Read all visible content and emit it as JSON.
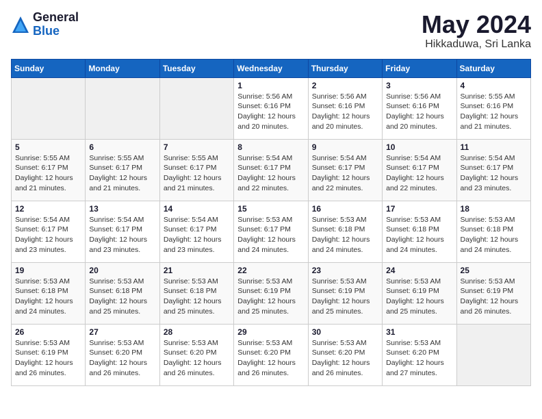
{
  "logo": {
    "general": "General",
    "blue": "Blue"
  },
  "title": "May 2024",
  "subtitle": "Hikkaduwa, Sri Lanka",
  "days_header": [
    "Sunday",
    "Monday",
    "Tuesday",
    "Wednesday",
    "Thursday",
    "Friday",
    "Saturday"
  ],
  "weeks": [
    [
      {
        "num": "",
        "detail": ""
      },
      {
        "num": "",
        "detail": ""
      },
      {
        "num": "",
        "detail": ""
      },
      {
        "num": "1",
        "detail": "Sunrise: 5:56 AM\nSunset: 6:16 PM\nDaylight: 12 hours\nand 20 minutes."
      },
      {
        "num": "2",
        "detail": "Sunrise: 5:56 AM\nSunset: 6:16 PM\nDaylight: 12 hours\nand 20 minutes."
      },
      {
        "num": "3",
        "detail": "Sunrise: 5:56 AM\nSunset: 6:16 PM\nDaylight: 12 hours\nand 20 minutes."
      },
      {
        "num": "4",
        "detail": "Sunrise: 5:55 AM\nSunset: 6:16 PM\nDaylight: 12 hours\nand 21 minutes."
      }
    ],
    [
      {
        "num": "5",
        "detail": "Sunrise: 5:55 AM\nSunset: 6:17 PM\nDaylight: 12 hours\nand 21 minutes."
      },
      {
        "num": "6",
        "detail": "Sunrise: 5:55 AM\nSunset: 6:17 PM\nDaylight: 12 hours\nand 21 minutes."
      },
      {
        "num": "7",
        "detail": "Sunrise: 5:55 AM\nSunset: 6:17 PM\nDaylight: 12 hours\nand 21 minutes."
      },
      {
        "num": "8",
        "detail": "Sunrise: 5:54 AM\nSunset: 6:17 PM\nDaylight: 12 hours\nand 22 minutes."
      },
      {
        "num": "9",
        "detail": "Sunrise: 5:54 AM\nSunset: 6:17 PM\nDaylight: 12 hours\nand 22 minutes."
      },
      {
        "num": "10",
        "detail": "Sunrise: 5:54 AM\nSunset: 6:17 PM\nDaylight: 12 hours\nand 22 minutes."
      },
      {
        "num": "11",
        "detail": "Sunrise: 5:54 AM\nSunset: 6:17 PM\nDaylight: 12 hours\nand 23 minutes."
      }
    ],
    [
      {
        "num": "12",
        "detail": "Sunrise: 5:54 AM\nSunset: 6:17 PM\nDaylight: 12 hours\nand 23 minutes."
      },
      {
        "num": "13",
        "detail": "Sunrise: 5:54 AM\nSunset: 6:17 PM\nDaylight: 12 hours\nand 23 minutes."
      },
      {
        "num": "14",
        "detail": "Sunrise: 5:54 AM\nSunset: 6:17 PM\nDaylight: 12 hours\nand 23 minutes."
      },
      {
        "num": "15",
        "detail": "Sunrise: 5:53 AM\nSunset: 6:17 PM\nDaylight: 12 hours\nand 24 minutes."
      },
      {
        "num": "16",
        "detail": "Sunrise: 5:53 AM\nSunset: 6:18 PM\nDaylight: 12 hours\nand 24 minutes."
      },
      {
        "num": "17",
        "detail": "Sunrise: 5:53 AM\nSunset: 6:18 PM\nDaylight: 12 hours\nand 24 minutes."
      },
      {
        "num": "18",
        "detail": "Sunrise: 5:53 AM\nSunset: 6:18 PM\nDaylight: 12 hours\nand 24 minutes."
      }
    ],
    [
      {
        "num": "19",
        "detail": "Sunrise: 5:53 AM\nSunset: 6:18 PM\nDaylight: 12 hours\nand 24 minutes."
      },
      {
        "num": "20",
        "detail": "Sunrise: 5:53 AM\nSunset: 6:18 PM\nDaylight: 12 hours\nand 25 minutes."
      },
      {
        "num": "21",
        "detail": "Sunrise: 5:53 AM\nSunset: 6:18 PM\nDaylight: 12 hours\nand 25 minutes."
      },
      {
        "num": "22",
        "detail": "Sunrise: 5:53 AM\nSunset: 6:19 PM\nDaylight: 12 hours\nand 25 minutes."
      },
      {
        "num": "23",
        "detail": "Sunrise: 5:53 AM\nSunset: 6:19 PM\nDaylight: 12 hours\nand 25 minutes."
      },
      {
        "num": "24",
        "detail": "Sunrise: 5:53 AM\nSunset: 6:19 PM\nDaylight: 12 hours\nand 25 minutes."
      },
      {
        "num": "25",
        "detail": "Sunrise: 5:53 AM\nSunset: 6:19 PM\nDaylight: 12 hours\nand 26 minutes."
      }
    ],
    [
      {
        "num": "26",
        "detail": "Sunrise: 5:53 AM\nSunset: 6:19 PM\nDaylight: 12 hours\nand 26 minutes."
      },
      {
        "num": "27",
        "detail": "Sunrise: 5:53 AM\nSunset: 6:20 PM\nDaylight: 12 hours\nand 26 minutes."
      },
      {
        "num": "28",
        "detail": "Sunrise: 5:53 AM\nSunset: 6:20 PM\nDaylight: 12 hours\nand 26 minutes."
      },
      {
        "num": "29",
        "detail": "Sunrise: 5:53 AM\nSunset: 6:20 PM\nDaylight: 12 hours\nand 26 minutes."
      },
      {
        "num": "30",
        "detail": "Sunrise: 5:53 AM\nSunset: 6:20 PM\nDaylight: 12 hours\nand 26 minutes."
      },
      {
        "num": "31",
        "detail": "Sunrise: 5:53 AM\nSunset: 6:20 PM\nDaylight: 12 hours\nand 27 minutes."
      },
      {
        "num": "",
        "detail": ""
      }
    ]
  ]
}
